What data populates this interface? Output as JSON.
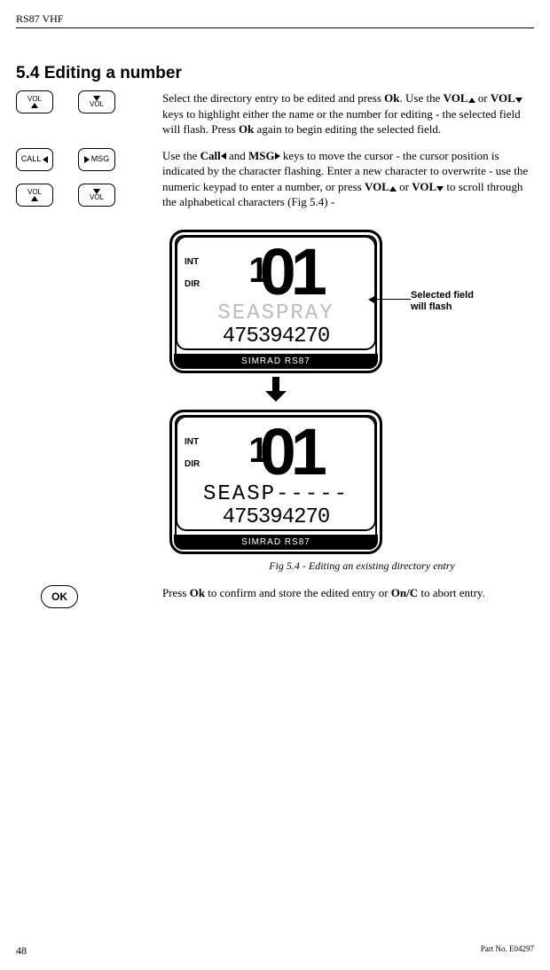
{
  "header": {
    "running": "RS87 VHF"
  },
  "section": {
    "number_title": "5.4  Editing a number"
  },
  "keys": {
    "vol": "VOL",
    "call": "CALL",
    "msg": "MSG",
    "ok": "OK"
  },
  "para1": {
    "a": "Select the directory entry to be edited and press ",
    "ok": "Ok",
    "b": ".  Use the ",
    "vol": "VOL",
    "c": " or ",
    "d": " keys to highlight either the name or the number for editing - the selected field will flash.  Press ",
    "e": " again to begin editing the selected field."
  },
  "para2": {
    "a": "Use the ",
    "call": "Call",
    "b": " and ",
    "msg": "MSG",
    "c": " keys to move the cursor - the cursor position is indicated by the character flashing.  Enter a new character to overwrite - use the numeric keypad to enter a number, or press ",
    "vol": "VOL",
    "d": " or ",
    "e": " to scroll through the alphabetical characters (Fig 5.4) -"
  },
  "lcd": {
    "int": "INT",
    "dir": "DIR",
    "big": "01",
    "name1": "SEASPRAY",
    "name2": "SEASP-----",
    "num": "475394270",
    "brand": "SIMRAD RS87"
  },
  "annotation": "Selected field will flash",
  "caption": "Fig 5.4 - Editing an existing directory entry",
  "para3": {
    "a": "Press ",
    "ok": "Ok",
    "b": " to confirm and store the edited entry or ",
    "onc": "On/C",
    "c": " to abort entry."
  },
  "footer": {
    "page": "48",
    "part": "Part No. E04297"
  }
}
